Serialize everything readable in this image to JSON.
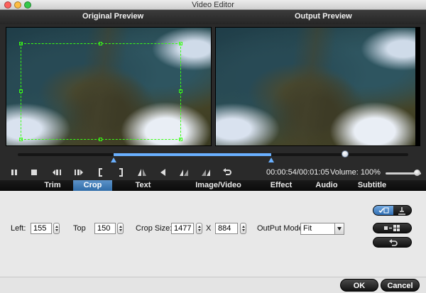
{
  "window": {
    "title": "Video Editor"
  },
  "preview": {
    "original_label": "Original Preview",
    "output_label": "Output Preview"
  },
  "timeline": {
    "progress_fraction": 0.83,
    "selection_start_fraction": 0.245,
    "selection_end_fraction": 0.65
  },
  "playback": {
    "time_display": "00:00:54/00:01:05",
    "volume_label": "Volume:",
    "volume_value": "100%",
    "icons": [
      "pause-icon",
      "stop-icon",
      "prev-frame-icon",
      "next-frame-icon",
      "mark-in-icon",
      "mark-out-icon",
      "flip-horizontal-icon",
      "rotate-left-icon",
      "flip-vertical-icon",
      "rotate-right-icon",
      "reset-icon"
    ]
  },
  "tabs": [
    {
      "label": "Trim"
    },
    {
      "label": "Crop",
      "active": true
    },
    {
      "label": "Text Watermark"
    },
    {
      "label": "Image/Video Watermark"
    },
    {
      "label": "Effect"
    },
    {
      "label": "Audio Editor"
    },
    {
      "label": "Subtitle"
    }
  ],
  "crop": {
    "left_label": "Left:",
    "left_value": "155",
    "top_label": "Top",
    "top_value": "150",
    "size_label": "Crop Size:",
    "width_value": "1477",
    "x_label": "X",
    "height_value": "884",
    "mode_label": "OutPut Mode",
    "mode_value": "Fit"
  },
  "footer": {
    "ok_label": "OK",
    "cancel_label": "Cancel"
  },
  "colors": {
    "accent": "#2f6ca8",
    "crop_border": "#39ff14",
    "panel_bg": "#e8e8e8"
  }
}
